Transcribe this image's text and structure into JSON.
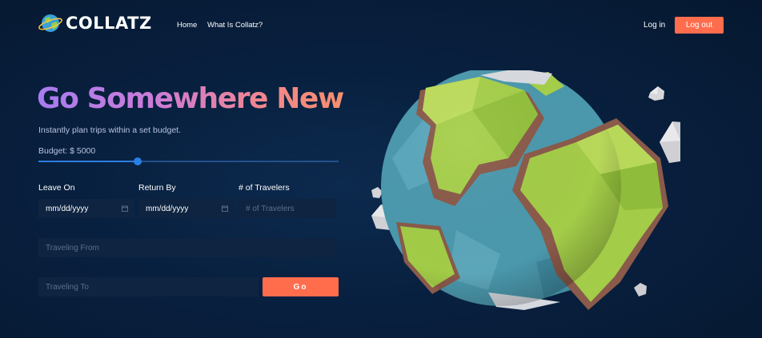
{
  "brand": {
    "name": "COLLATZ",
    "logo_icon": "globe-planet-icon"
  },
  "nav": {
    "home": "Home",
    "what_is": "What Is Collatz?"
  },
  "auth": {
    "login": "Log in",
    "logout": "Log out"
  },
  "hero": {
    "title": "Go Somewhere New",
    "subtitle": "Instantly plan trips within a set budget."
  },
  "budget": {
    "label": "Budget: $ 5000",
    "slider_fraction": 0.33
  },
  "form": {
    "leave_on": {
      "label": "Leave On",
      "value": "mm/dd/yyyy"
    },
    "return_by": {
      "label": "Return By",
      "value": "mm/dd/yyyy"
    },
    "travelers": {
      "label": "# of Travelers",
      "placeholder": "# of Travelers"
    },
    "from": {
      "placeholder": "Traveling From"
    },
    "to": {
      "placeholder": "Traveling To"
    },
    "go": "Go"
  },
  "colors": {
    "accent": "#ff6d4d",
    "slider": "#2a7fe4",
    "input_bg": "#0e2441",
    "background": "#08203f"
  }
}
